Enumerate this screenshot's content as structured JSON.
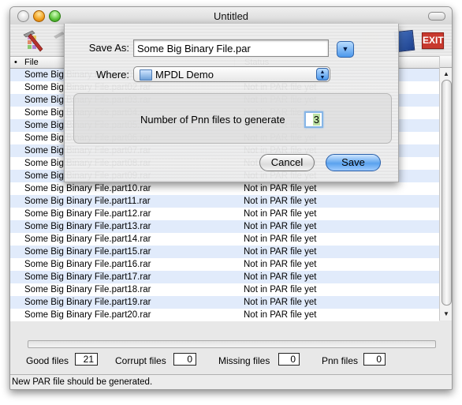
{
  "window": {
    "title": "Untitled"
  },
  "toolbar": {
    "icons": [
      "hammer-tool-icon",
      "hammer-icon",
      "smiley-icon",
      "mail-stamp-icon",
      "exit-icon"
    ],
    "exit_label": "EXIT"
  },
  "list": {
    "columns": [
      {
        "label": "File",
        "sort_marker": "•"
      },
      {
        "label": "Status"
      }
    ],
    "rows": [
      {
        "file": "Some Big Binary File.part01.rar",
        "status": "Not in PAR file yet"
      },
      {
        "file": "Some Big Binary File.part02.rar",
        "status": "Not in PAR file yet"
      },
      {
        "file": "Some Big Binary File.part03.rar",
        "status": "Not in PAR file yet"
      },
      {
        "file": "Some Big Binary File.part04.rar",
        "status": "Not in PAR file yet"
      },
      {
        "file": "Some Big Binary File.part05.rar",
        "status": "Not in PAR file yet"
      },
      {
        "file": "Some Big Binary File.part06.rar",
        "status": "Not in PAR file yet"
      },
      {
        "file": "Some Big Binary File.part07.rar",
        "status": "Not in PAR file yet"
      },
      {
        "file": "Some Big Binary File.part08.rar",
        "status": "Not in PAR file yet"
      },
      {
        "file": "Some Big Binary File.part09.rar",
        "status": "Not in PAR file yet"
      },
      {
        "file": "Some Big Binary File.part10.rar",
        "status": "Not in PAR file yet"
      },
      {
        "file": "Some Big Binary File.part11.rar",
        "status": "Not in PAR file yet"
      },
      {
        "file": "Some Big Binary File.part12.rar",
        "status": "Not in PAR file yet"
      },
      {
        "file": "Some Big Binary File.part13.rar",
        "status": "Not in PAR file yet"
      },
      {
        "file": "Some Big Binary File.part14.rar",
        "status": "Not in PAR file yet"
      },
      {
        "file": "Some Big Binary File.part15.rar",
        "status": "Not in PAR file yet"
      },
      {
        "file": "Some Big Binary File.part16.rar",
        "status": "Not in PAR file yet"
      },
      {
        "file": "Some Big Binary File.part17.rar",
        "status": "Not in PAR file yet"
      },
      {
        "file": "Some Big Binary File.part18.rar",
        "status": "Not in PAR file yet"
      },
      {
        "file": "Some Big Binary File.part19.rar",
        "status": "Not in PAR file yet"
      },
      {
        "file": "Some Big Binary File.part20.rar",
        "status": "Not in PAR file yet"
      }
    ]
  },
  "stats": {
    "good": {
      "label": "Good files",
      "value": "21"
    },
    "corrupt": {
      "label": "Corrupt files",
      "value": "0"
    },
    "missing": {
      "label": "Missing files",
      "value": "0"
    },
    "pnn": {
      "label": "Pnn files",
      "value": "0"
    }
  },
  "progress": {
    "fraction": 0
  },
  "statusbar": {
    "text": "New PAR file should be generated."
  },
  "sheet": {
    "save_as_label": "Save As:",
    "save_as_value": "Some Big Binary File.par",
    "where_label": "Where:",
    "where_value": "MPDL Demo",
    "pnn_label": "Number of Pnn files to generate",
    "pnn_value": "3",
    "cancel_label": "Cancel",
    "save_label": "Save"
  },
  "glyphs": {
    "up": "▲",
    "down": "▼",
    "disclose": "▼",
    "popup_up": "▲",
    "popup_down": "▼"
  }
}
